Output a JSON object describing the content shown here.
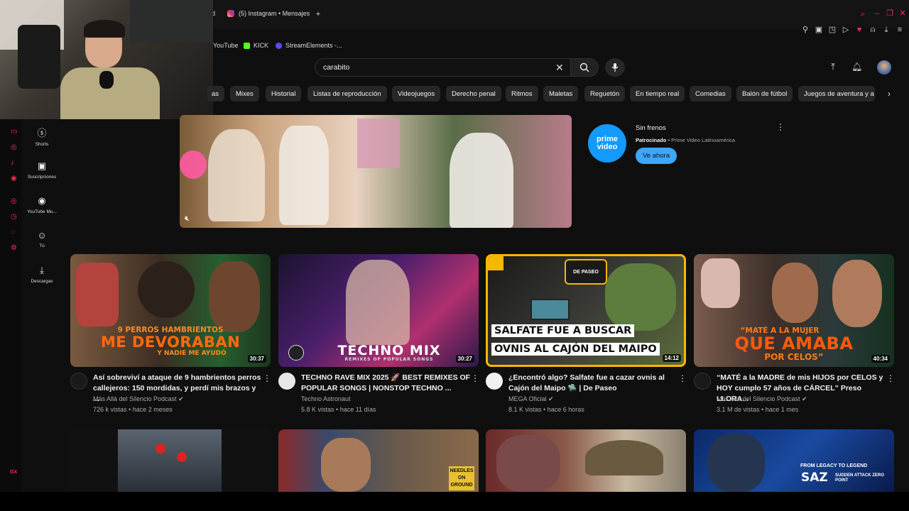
{
  "browser": {
    "tab_partial": "d",
    "tab_instagram": "(5) Instagram • Mensajes",
    "bookmarks": [
      "YouTube",
      "KICK",
      "StreamElements -..."
    ],
    "gx_label": "GX"
  },
  "header": {
    "search_value": "carabito"
  },
  "chips": [
    "as",
    "Mixes",
    "Historial",
    "Listas de reproducción",
    "Videojuegos",
    "Derecho penal",
    "Ritmos",
    "Maletas",
    "Reguetón",
    "En tiempo real",
    "Comedias",
    "Balón de fútbol",
    "Juegos de aventura y a"
  ],
  "sidebar": [
    {
      "label": "Shorts",
      "icon": "shorts-icon"
    },
    {
      "label": "Suscripciones",
      "icon": "subscriptions-icon"
    },
    {
      "label": "YouTube Mu...",
      "icon": "youtube-music-icon"
    },
    {
      "label": "Tú",
      "icon": "you-icon"
    },
    {
      "label": "Descargas",
      "icon": "download-icon"
    }
  ],
  "ad": {
    "logo_text": "prime video",
    "title": "Sin frenos",
    "sponsored": "Patrocinado",
    "advertiser": "Prime Video Latinoamérica",
    "cta": "Ve ahora"
  },
  "videos": [
    {
      "thumb_small": "9 PERROS HAMBRIENTOS",
      "thumb_big": "ME DEVORABAN",
      "thumb_sub": "Y NADIE ME AYUDÓ",
      "duration": "30:37",
      "title_line1": "Así sobreviví a ataque de 9 hambrientos perros",
      "title_line2": "callejeros: 150 mordidas, y perdí mis brazos y ...",
      "channel": "Más Allá del Silencio Podcast",
      "views": "726 k vistas",
      "age": "hace 2 meses"
    },
    {
      "thumb_big": "TECHNO MIX",
      "thumb_sub": "REMIXES OF POPULAR SONGS",
      "duration": "30:27",
      "title_line1": "TECHNO RAVE MIX 2025 🚀 BEST REMIXES OF",
      "title_line2": "POPULAR SONGS | NONSTOP TECHNO ...",
      "channel": "Techno Astronaut",
      "views": "5.8 K vistas",
      "age": "hace 11 días"
    },
    {
      "thumb_badge": "DE PASEO",
      "thumb_line1": "SALFATE FUE A BUSCAR",
      "thumb_line2": "OVNIS AL CAJÓN DEL MAIPO",
      "duration": "14:12",
      "title_line1": "¿Encontró algo? Salfate fue a cazar ovnis al",
      "title_line2": "Cajón del Maipo 🛸 | De Paseo",
      "channel": "MEGA Oficial",
      "views": "8.1 K vistas",
      "age": "hace 6 horas"
    },
    {
      "thumb_small": "“MATÉ A LA MUJER",
      "thumb_big": "QUE AMABA",
      "thumb_sub": "POR CELOS”",
      "duration": "40:34",
      "title_line1": "“MATÉ a la MADRE de mis HIJOS por CELOS y",
      "title_line2": "HOY cumplo 57 años de CÁRCEL” Preso LLORA...",
      "channel": "Más Allá del Silencio Podcast",
      "views": "3.1 M de vistas",
      "age": "hace 1 mes"
    }
  ],
  "row2": {
    "thumb2_text": "NEEDLES ON GROUND",
    "thumb4_line1": "FROM LEGACY TO LEGEND",
    "thumb4_logo": "SAZ",
    "thumb4_logo_sub": "SUDDEN ATTACK ZERO POINT"
  },
  "colors": {
    "bg": "#0f0f0f",
    "accent_red": "#ff0033",
    "prime_blue": "#1399ff",
    "cta_blue": "#3ea6ff"
  }
}
